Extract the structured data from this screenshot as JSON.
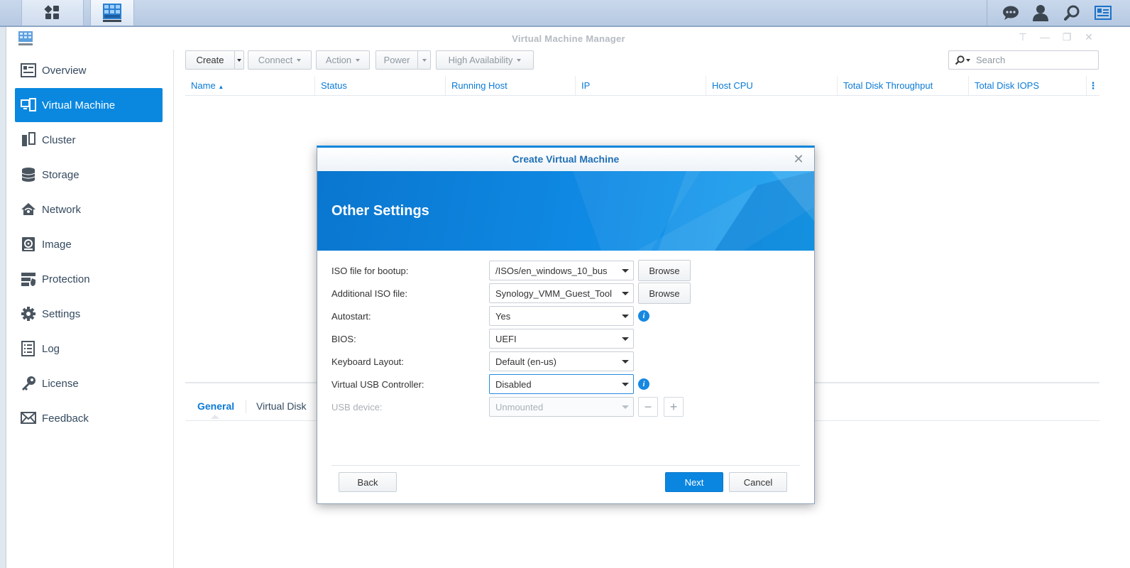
{
  "taskbar": {
    "icons": [
      "main-menu-icon",
      "vmm-app-icon",
      "chat-icon",
      "user-icon",
      "search-icon",
      "widgets-icon"
    ]
  },
  "window": {
    "title": "Virtual Machine Manager",
    "controls": [
      "pin-icon",
      "minimize-icon",
      "maximize-icon",
      "close-icon"
    ]
  },
  "sidebar": {
    "items": [
      {
        "label": "Overview",
        "icon": "overview-icon"
      },
      {
        "label": "Virtual Machine",
        "icon": "virtual-machine-icon",
        "active": true
      },
      {
        "label": "Cluster",
        "icon": "cluster-icon"
      },
      {
        "label": "Storage",
        "icon": "storage-icon"
      },
      {
        "label": "Network",
        "icon": "network-icon"
      },
      {
        "label": "Image",
        "icon": "image-icon"
      },
      {
        "label": "Protection",
        "icon": "protection-icon"
      },
      {
        "label": "Settings",
        "icon": "settings-icon"
      },
      {
        "label": "Log",
        "icon": "log-icon"
      },
      {
        "label": "License",
        "icon": "license-icon"
      },
      {
        "label": "Feedback",
        "icon": "feedback-icon"
      }
    ]
  },
  "toolbar": {
    "create": "Create",
    "connect": "Connect",
    "action": "Action",
    "power": "Power",
    "high_availability": "High Availability",
    "search_placeholder": "Search"
  },
  "grid": {
    "columns": [
      "Name",
      "Status",
      "Running Host",
      "IP",
      "Host CPU",
      "Total Disk Throughput",
      "Total Disk IOPS"
    ],
    "sort_indicator": "▲"
  },
  "bottom_tabs": {
    "general": "General",
    "virtual_disk": "Virtual Disk"
  },
  "dialog": {
    "title": "Create Virtual Machine",
    "heading": "Other Settings",
    "fields": {
      "iso_boot": {
        "label": "ISO file for bootup:",
        "value": "/ISOs/en_windows_10_bus",
        "button": "Browse"
      },
      "additional_iso": {
        "label": "Additional ISO file:",
        "value": "Synology_VMM_Guest_Tool",
        "button": "Browse"
      },
      "autostart": {
        "label": "Autostart:",
        "value": "Yes"
      },
      "bios": {
        "label": "BIOS:",
        "value": "UEFI"
      },
      "keyboard": {
        "label": "Keyboard Layout:",
        "value": "Default (en-us)"
      },
      "usb_controller": {
        "label": "Virtual USB Controller:",
        "value": "Disabled"
      },
      "usb_device": {
        "label": "USB device:",
        "value": "Unmounted"
      }
    },
    "buttons": {
      "back": "Back",
      "next": "Next",
      "cancel": "Cancel"
    }
  },
  "colors": {
    "accent": "#0a88e0",
    "header_link": "#0a7ad6"
  }
}
